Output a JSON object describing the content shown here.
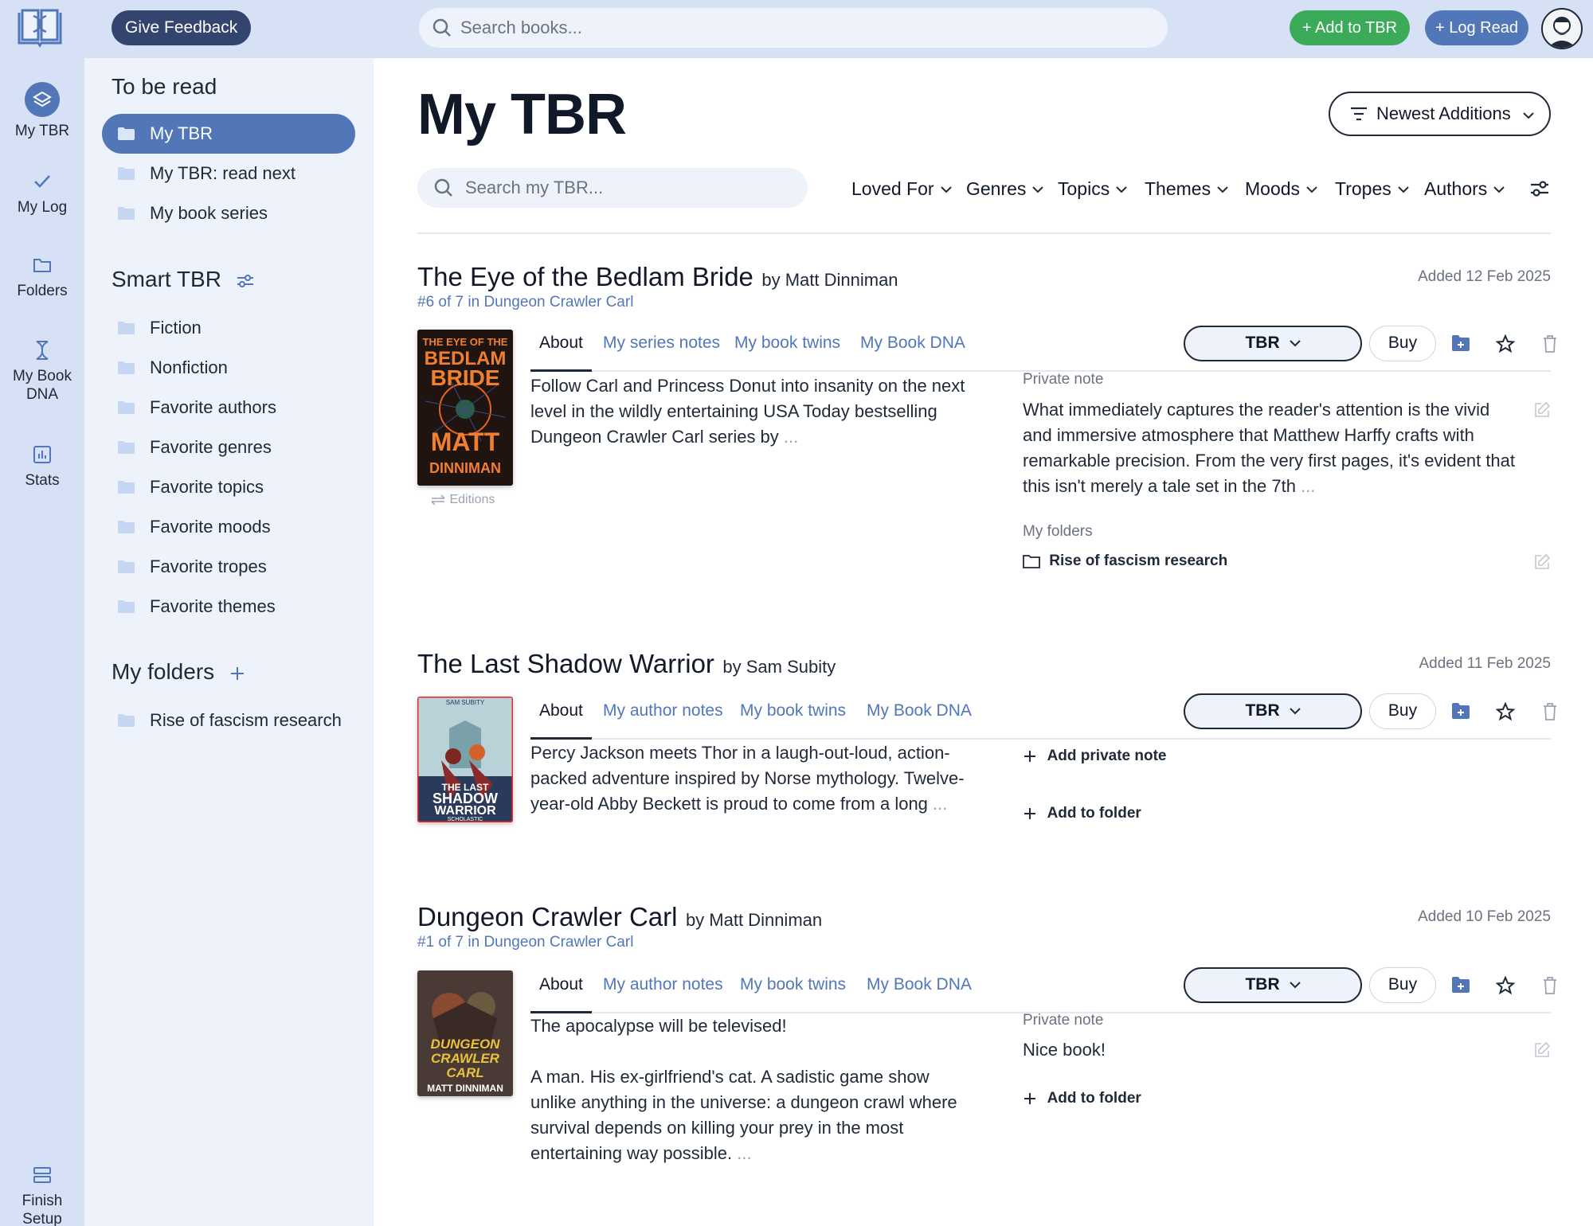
{
  "topbar": {
    "feedback_label": "Give Feedback",
    "search_placeholder": "Search books...",
    "add_tbr_label": "+ Add to TBR",
    "log_read_label": "+ Log Read"
  },
  "rail": {
    "items": [
      {
        "label": "My TBR",
        "icon": "layers-icon"
      },
      {
        "label": "My Log",
        "icon": "check-icon"
      },
      {
        "label": "Folders",
        "icon": "folder-icon"
      },
      {
        "label": "My Book DNA",
        "icon": "dna-icon"
      },
      {
        "label": "Stats",
        "icon": "chart-icon"
      },
      {
        "label": "Finish Setup",
        "icon": "setup-icon"
      }
    ]
  },
  "sidebar": {
    "to_be_read_heading": "To be read",
    "tbr_items": [
      "My TBR",
      "My TBR: read next",
      "My book series"
    ],
    "smart_heading": "Smart TBR",
    "smart_items": [
      "Fiction",
      "Nonfiction",
      "Favorite authors",
      "Favorite genres",
      "Favorite topics",
      "Favorite moods",
      "Favorite tropes",
      "Favorite themes"
    ],
    "folders_heading": "My folders",
    "folder_items": [
      "Rise of fascism research"
    ]
  },
  "main": {
    "title": "My TBR",
    "sort_label": "Newest Additions",
    "search_placeholder": "Search my TBR...",
    "filters": [
      "Loved For",
      "Genres",
      "Topics",
      "Themes",
      "Moods",
      "Tropes",
      "Authors"
    ]
  },
  "books": [
    {
      "title": "The Eye of the Bedlam Bride",
      "by": "by Matt Dinniman",
      "series": "#6 of 7 in Dungeon Crawler Carl",
      "added": "Added 12 Feb 2025",
      "editions": "Editions",
      "tabs": [
        "About",
        "My series notes",
        "My book twins",
        "My Book DNA"
      ],
      "status": "TBR",
      "buy": "Buy",
      "about": "Follow Carl and Princess Donut into insanity on the next level in the wildly entertaining USA Today bestselling Dungeon Crawler Carl series by",
      "note_label": "Private note",
      "note": "What immediately captures the reader's attention is the vivid and immersive atmosphere that Matthew Harffy crafts with remarkable precision. From the very first pages, it's evident that this isn't merely a tale set in the 7th",
      "folders_label": "My folders",
      "folder": "Rise of fascism research"
    },
    {
      "title": "The Last Shadow Warrior",
      "by": "by Sam Subity",
      "added": "Added 11 Feb 2025",
      "tabs": [
        "About",
        "My author notes",
        "My book twins",
        "My Book DNA"
      ],
      "status": "TBR",
      "buy": "Buy",
      "about": "Percy Jackson meets Thor in a laugh-out-loud, action-packed adventure inspired by Norse mythology. Twelve-year-old Abby Beckett is proud to come from a long",
      "add_note": "Add private note",
      "add_folder": "Add to folder"
    },
    {
      "title": "Dungeon Crawler Carl",
      "by": "by Matt Dinniman",
      "series": "#1 of 7 in Dungeon Crawler Carl",
      "added": "Added 10 Feb 2025",
      "tabs": [
        "About",
        "My author notes",
        "My book twins",
        "My Book DNA"
      ],
      "status": "TBR",
      "buy": "Buy",
      "about_line1": "The apocalypse will be televised!",
      "about_line2": "A man. His ex-girlfriend's cat. A sadistic game show unlike anything in the universe: a dungeon crawl where survival depends on killing your prey in the most entertaining way possible.",
      "note_label": "Private note",
      "note": "Nice book!",
      "add_folder": "Add to folder"
    }
  ],
  "ellipsis": "...",
  "covers": [
    {
      "lines": [
        "THE EYE OF THE",
        "BEDLAM",
        "BRIDE",
        "MATT",
        "DINNIMAN"
      ],
      "bg": "#e8621b"
    },
    {
      "lines": [
        "SAM SUBITY",
        "THE LAST",
        "SHADOW",
        "WARRIOR",
        "SCHOLASTIC"
      ],
      "bg": "#b8d2d8"
    },
    {
      "lines": [
        "DUNGEON",
        "CRAWLER",
        "CARL",
        "MATT DINNIMAN"
      ],
      "bg": "#4a3a35"
    }
  ],
  "colors": {
    "accent": "#5277b9",
    "green": "#3cab59",
    "navy": "#33456e",
    "sidebar": "#eef2fb",
    "rail": "#d6e1f6"
  }
}
